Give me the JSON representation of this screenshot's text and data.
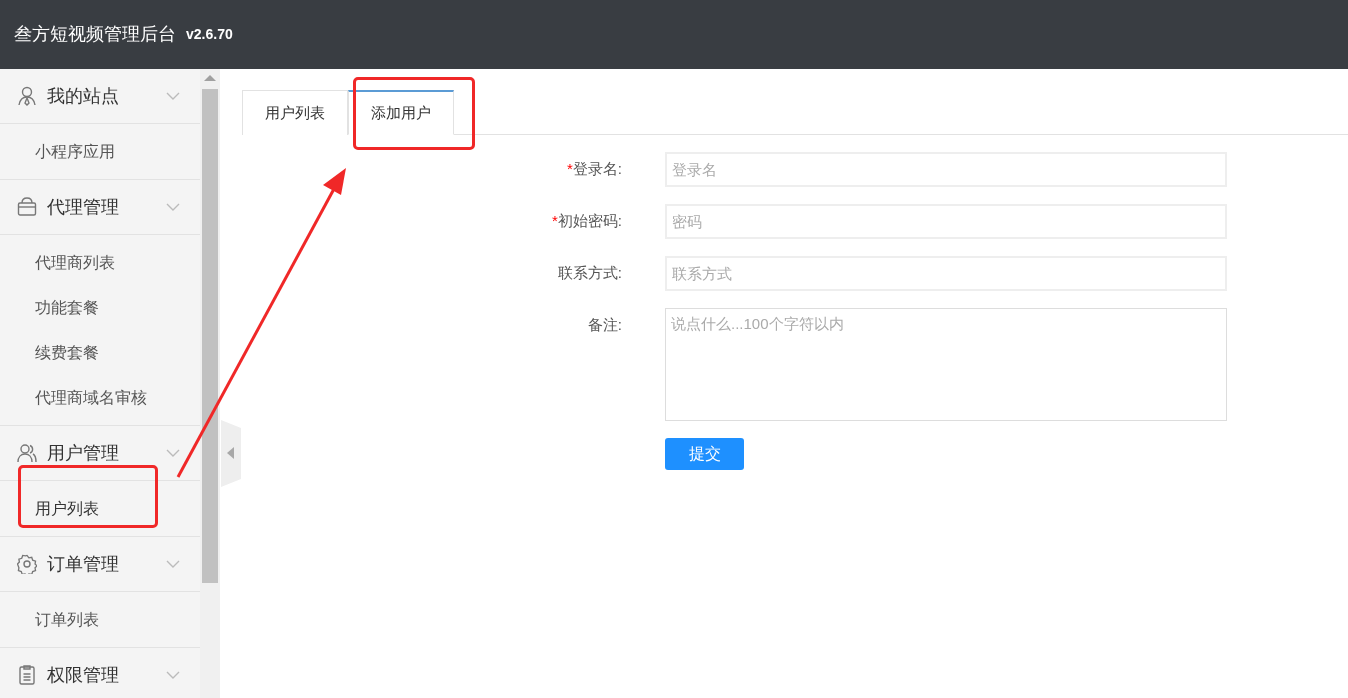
{
  "header": {
    "title": "叁方短视频管理后台",
    "version": "v2.6.70"
  },
  "sidebar": {
    "groups": [
      {
        "label": "我的站点",
        "kind": "person",
        "children": [
          {
            "label": "小程序应用",
            "selected": false
          }
        ]
      },
      {
        "label": "代理管理",
        "kind": "bag",
        "children": [
          {
            "label": "代理商列表",
            "selected": false
          },
          {
            "label": "功能套餐",
            "selected": false
          },
          {
            "label": "续费套餐",
            "selected": false
          },
          {
            "label": "代理商域名审核",
            "selected": false
          }
        ]
      },
      {
        "label": "用户管理",
        "kind": "people",
        "children": [
          {
            "label": "用户列表",
            "selected": true
          }
        ]
      },
      {
        "label": "订单管理",
        "kind": "gear",
        "children": [
          {
            "label": "订单列表",
            "selected": false
          }
        ]
      },
      {
        "label": "权限管理",
        "kind": "clipboard"
      }
    ]
  },
  "tabs": [
    {
      "label": "用户列表",
      "selected": false
    },
    {
      "label": "添加用户",
      "selected": true
    }
  ],
  "form": {
    "fields": [
      {
        "label": "登录名:",
        "marker": "*",
        "kind": "input",
        "placeholder": "登录名"
      },
      {
        "label": "初始密码:",
        "marker": "*",
        "kind": "input",
        "placeholder": "密码"
      },
      {
        "label": "联系方式:",
        "kind": "input",
        "placeholder": "联系方式"
      },
      {
        "label": "备注:",
        "kind": "textarea",
        "placeholder": "说点什么...100个字符以内"
      }
    ],
    "submit": "提交"
  }
}
